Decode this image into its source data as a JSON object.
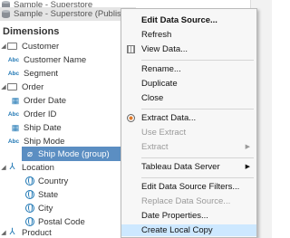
{
  "data_sources": [
    {
      "name": "Sample - Superstore"
    },
    {
      "name": "Sample - Superstore (Published)"
    }
  ],
  "dimensions_header": "Dimensions",
  "tree": [
    {
      "label": "Customer",
      "kind": "folder",
      "expanded": true
    },
    {
      "label": "Customer Name",
      "kind": "abc",
      "badge": "Abc"
    },
    {
      "label": "Segment",
      "kind": "abc",
      "badge": "Abc"
    },
    {
      "label": "Order",
      "kind": "folder",
      "expanded": true
    },
    {
      "label": "Order Date",
      "kind": "date"
    },
    {
      "label": "Order ID",
      "kind": "abc",
      "badge": "Abc"
    },
    {
      "label": "Ship Date",
      "kind": "date"
    },
    {
      "label": "Ship Mode",
      "kind": "abc",
      "badge": "Abc"
    },
    {
      "label": "Ship Mode (group)",
      "kind": "group",
      "selected": true
    },
    {
      "label": "Location",
      "kind": "hierarchy",
      "expanded": true
    },
    {
      "label": "Country",
      "kind": "geo"
    },
    {
      "label": "State",
      "kind": "geo"
    },
    {
      "label": "City",
      "kind": "geo"
    },
    {
      "label": "Postal Code",
      "kind": "geo"
    },
    {
      "label": "Product",
      "kind": "hierarchy",
      "expanded": true
    }
  ],
  "menu": [
    {
      "label": "Edit Data Source...",
      "enabled": true
    },
    {
      "label": "Refresh",
      "enabled": true
    },
    {
      "label": "View Data...",
      "enabled": true,
      "icon": "grid-icon"
    },
    {
      "label": "Rename...",
      "enabled": true
    },
    {
      "label": "Duplicate",
      "enabled": true
    },
    {
      "label": "Close",
      "enabled": true
    },
    {
      "label": "Extract Data...",
      "enabled": true,
      "icon": "extract-icon"
    },
    {
      "label": "Use Extract",
      "enabled": false
    },
    {
      "label": "Extract",
      "enabled": false,
      "submenu": true
    },
    {
      "label": "Tableau Data Server",
      "enabled": true,
      "submenu": true
    },
    {
      "label": "Edit Data Source Filters...",
      "enabled": true
    },
    {
      "label": "Replace Data Source...",
      "enabled": false
    },
    {
      "label": "Date Properties...",
      "enabled": true
    },
    {
      "label": "Create Local Copy",
      "enabled": true,
      "highlighted": true
    }
  ],
  "submenu_arrow": "▶"
}
